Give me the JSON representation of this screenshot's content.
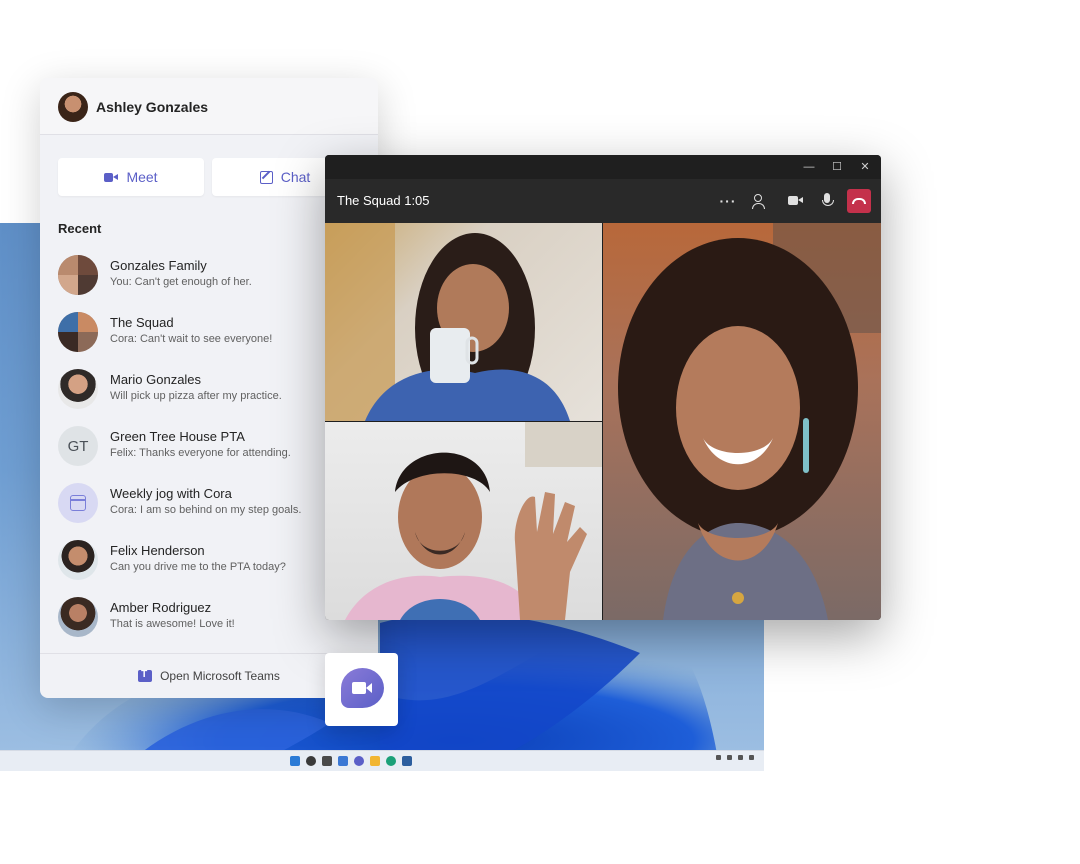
{
  "user": {
    "name": "Ashley Gonzales"
  },
  "actions": {
    "meet_label": "Meet",
    "chat_label": "Chat"
  },
  "recent": {
    "label": "Recent",
    "items": [
      {
        "title": "Gonzales Family",
        "preview": "You: Can't get enough of her.",
        "avatar": "group-photo"
      },
      {
        "title": "The Squad",
        "preview": "Cora: Can't wait to see everyone!",
        "avatar": "group-photo"
      },
      {
        "title": "Mario Gonzales",
        "preview": "Will pick up pizza after my practice.",
        "avatar": "person-photo"
      },
      {
        "title": "Green Tree House PTA",
        "preview": "Felix: Thanks everyone for attending.",
        "avatar": "initials",
        "initials": "GT"
      },
      {
        "title": "Weekly jog with Cora",
        "preview": "Cora: I am so behind on my step goals.",
        "avatar": "calendar-icon"
      },
      {
        "title": "Felix Henderson",
        "preview": "Can you drive me to the PTA today?",
        "avatar": "person-photo"
      },
      {
        "title": "Amber Rodriguez",
        "preview": "That is awesome! Love it!",
        "avatar": "person-photo"
      }
    ]
  },
  "footer": {
    "open_teams_label": "Open Microsoft Teams"
  },
  "call": {
    "title": "The Squad 1:05",
    "more_glyph": "···",
    "window_controls": {
      "minimize": "—",
      "maximize": "☐",
      "close": "✕"
    }
  },
  "colors": {
    "accent": "#5b5fc7",
    "hangup": "#c4314b",
    "call_bar": "#292929"
  }
}
